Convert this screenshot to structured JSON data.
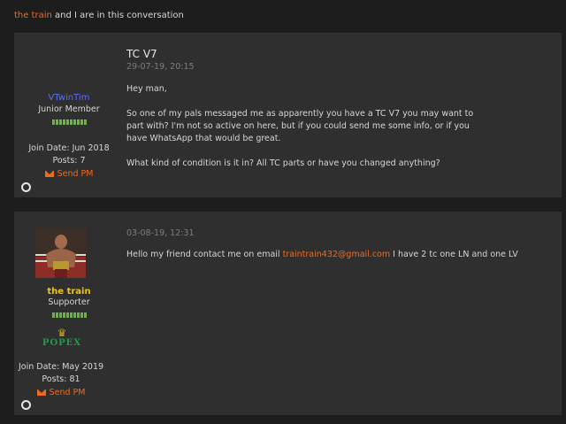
{
  "conversation": {
    "participant_name": "the train",
    "participant_suffix": " and I are in this conversation"
  },
  "posts": [
    {
      "username": "VTwinTim",
      "rank": "Junior Member",
      "join_date": "Join Date: Jun 2018",
      "posts": "Posts: 7",
      "send_pm": "Send PM",
      "title": "TC V7",
      "date": "29-07-19, 20:15",
      "body": [
        "Hey man,",
        "So one of my pals messaged me as apparently you have a TC V7 you may want to part with? I'm not so active on here, but if you could send me some info, or if you have WhatsApp that would be great.",
        "What kind of condition is it in? All TC parts or have you changed anything?"
      ]
    },
    {
      "username": "the train",
      "rank": "Supporter",
      "sponsor_text": "POPEX",
      "join_date": "Join Date: May 2019",
      "posts": "Posts: 81",
      "send_pm": "Send PM",
      "date": "03-08-19, 12:31",
      "body_before": "Hello my friend contact me on email ",
      "email": "traintrain432@gmail.com",
      "body_after": " I have 2 tc one LN and one LV"
    }
  ],
  "colors": {
    "accent": "#f06a1e",
    "username_blue": "#5d6cf0",
    "username_gold": "#f5c400",
    "reputation_green": "#5fbf2a",
    "panel_bg": "#2f2f2f",
    "page_bg": "#1d1d1d"
  }
}
